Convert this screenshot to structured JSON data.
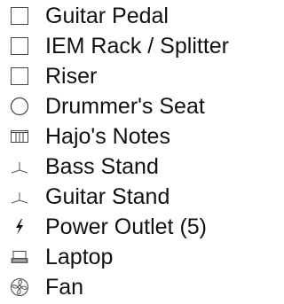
{
  "legend": {
    "items": [
      {
        "label": "Guitar Pedal",
        "icon": "square-outline-icon"
      },
      {
        "label": "IEM Rack / Splitter",
        "icon": "square-outline-icon"
      },
      {
        "label": "Riser",
        "icon": "square-outline-icon"
      },
      {
        "label": "Drummer's Seat",
        "icon": "circle-outline-icon"
      },
      {
        "label": "Hajo's Notes",
        "icon": "notes-icon"
      },
      {
        "label": "Bass Stand",
        "icon": "stand-icon"
      },
      {
        "label": "Guitar Stand",
        "icon": "stand-icon"
      },
      {
        "label": "Power Outlet (5)",
        "icon": "lightning-bolt-icon"
      },
      {
        "label": "Laptop",
        "icon": "laptop-icon"
      },
      {
        "label": "Fan",
        "icon": "fan-icon"
      }
    ]
  },
  "colors": {
    "text": "#111111",
    "icon_stroke": "#444444",
    "background": "#ffffff"
  }
}
